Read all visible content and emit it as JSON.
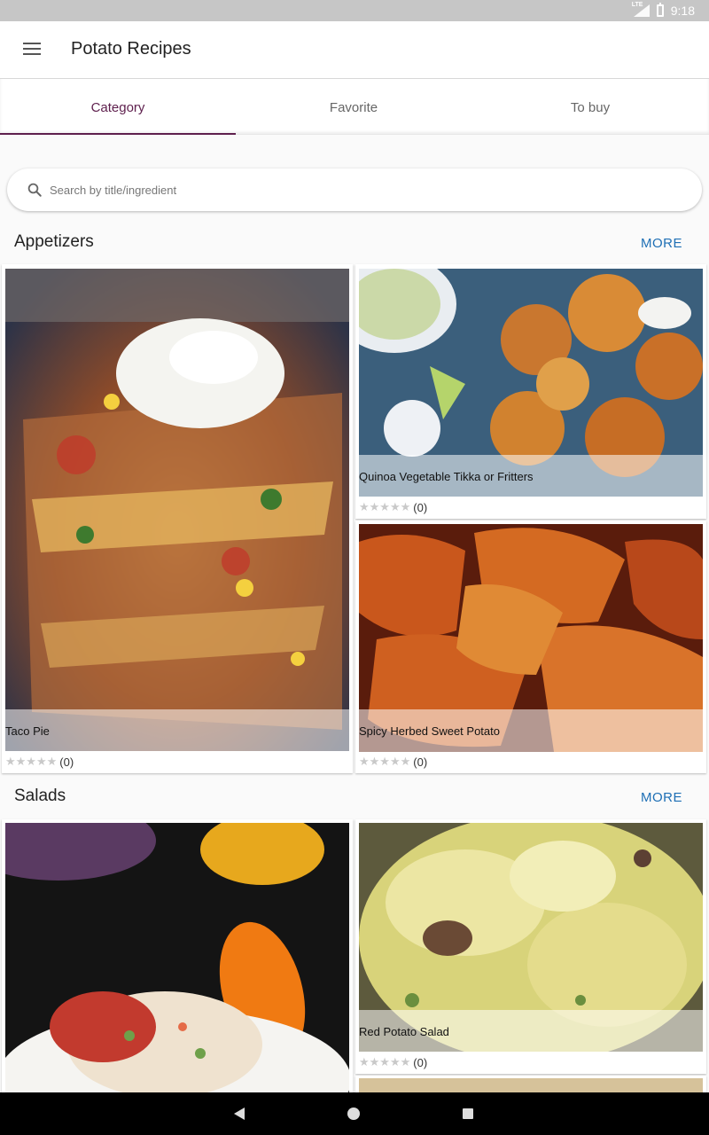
{
  "status_bar": {
    "network": "LTE",
    "time": "9:18"
  },
  "app_bar": {
    "title": "Potato Recipes",
    "menu_icon": "menu-icon"
  },
  "tabs": [
    {
      "label": "Category",
      "active": true
    },
    {
      "label": "Favorite",
      "active": false
    },
    {
      "label": "To buy",
      "active": false
    }
  ],
  "search": {
    "placeholder": "Search by title/ingredient",
    "value": ""
  },
  "sections": [
    {
      "title": "Appetizers",
      "more_label": "MORE",
      "recipes": [
        {
          "title": "Taco Pie",
          "rating_count": "(0)"
        },
        {
          "title": "Quinoa Vegetable Tikka or Fritters",
          "rating_count": "(0)"
        },
        {
          "title": "Spicy Herbed Sweet Potato",
          "rating_count": "(0)"
        }
      ]
    },
    {
      "title": "Salads",
      "more_label": "MORE",
      "recipes": [
        {
          "title": "",
          "rating_count": ""
        },
        {
          "title": "Red Potato Salad",
          "rating_count": "(0)"
        }
      ]
    }
  ],
  "stars": "★★★★★",
  "colors": {
    "accent": "#5e1f4d",
    "link": "#1e6fb5"
  }
}
